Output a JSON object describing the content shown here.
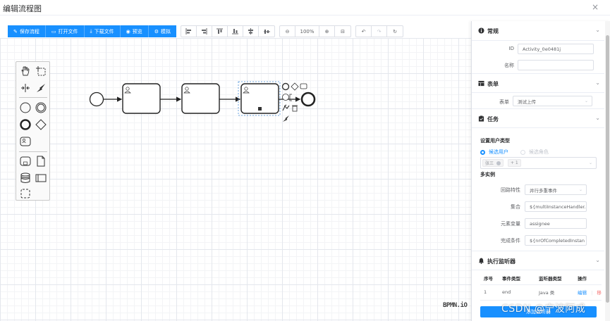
{
  "window": {
    "title": "编辑流程图",
    "close": "×"
  },
  "toolbar": {
    "save": "保存流程",
    "open": "打开文件",
    "download": "下载文件",
    "preview": "预览",
    "simulate": "模拟",
    "zoom": "100%"
  },
  "canvas": {
    "logo": "BPMN.iO"
  },
  "panel": {
    "general": {
      "title": "常规",
      "id_label": "ID",
      "id_value": "Activity_0e0481j",
      "name_label": "名称",
      "name_value": ""
    },
    "form": {
      "title": "表单",
      "form_label": "表单",
      "form_value": "测试上传"
    },
    "task": {
      "title": "任务",
      "user_type_title": "设置用户类型",
      "radio_user": "候选用户",
      "radio_role": "候选角色",
      "tag_user": "张三",
      "tag_more": "+ 1",
      "multi_title": "多实例",
      "loop_label": "回路特性",
      "loop_value": "并行多重事件",
      "collection_label": "集合",
      "collection_value": "${multiInstanceHandler.",
      "element_var_label": "元素变量",
      "element_var_value": "assignee",
      "completion_label": "完成条件",
      "completion_value": "${nrOfCompletedInstan"
    },
    "listener": {
      "title": "执行监听器",
      "headers": [
        "序号",
        "事件类型",
        "监听器类型",
        "操作"
      ],
      "rows": [
        {
          "index": "1",
          "event": "end",
          "type": "Java 类",
          "edit": "编辑",
          "delete": "移"
        }
      ],
      "add_button": "添加监听器"
    }
  },
  "watermark": "CSDN @宁波阿成",
  "colors": {
    "primary": "#1890ff",
    "danger": "#f56c6c",
    "border": "#dcdfe6"
  }
}
